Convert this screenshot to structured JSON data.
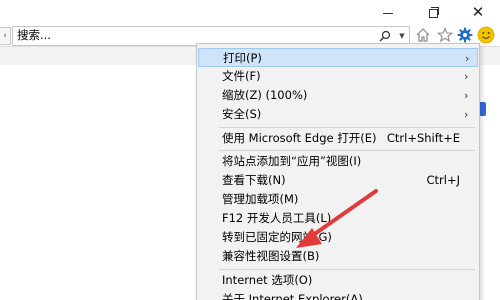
{
  "search": {
    "value": "搜索..."
  },
  "window_controls": {
    "minimize": "minimize-icon",
    "restore": "restore-icon",
    "close": "close-icon"
  },
  "toolbar_icons": [
    "home-icon",
    "favorites-star-icon",
    "tools-gear-icon",
    "feedback-smiley-icon"
  ],
  "colors": {
    "highlight": "#cfe4f8",
    "menu_bg": "#f2f2f2",
    "gear": "#1f6fc8",
    "smiley": "#f2c200",
    "arrow": "#e23a3a"
  },
  "menu": {
    "items": [
      {
        "label": "打印(P)",
        "submenu": true,
        "highlighted": true
      },
      {
        "label": "文件(F)",
        "submenu": true
      },
      {
        "label": "缩放(Z) (100%)",
        "submenu": true
      },
      {
        "label": "安全(S)",
        "submenu": true
      },
      {
        "label": "使用 Microsoft Edge 打开(E)",
        "shortcut": "Ctrl+Shift+E"
      },
      {
        "label": "将站点添加到“应用”视图(I)"
      },
      {
        "label": "查看下载(N)",
        "shortcut": "Ctrl+J"
      },
      {
        "label": "管理加载项(M)"
      },
      {
        "label": "F12 开发人员工具(L)"
      },
      {
        "label": "转到已固定的网站(G)"
      },
      {
        "label": "兼容性视图设置(B)"
      },
      {
        "label": "Internet 选项(O)"
      },
      {
        "label": "关于 Internet Explorer(A)"
      }
    ]
  }
}
